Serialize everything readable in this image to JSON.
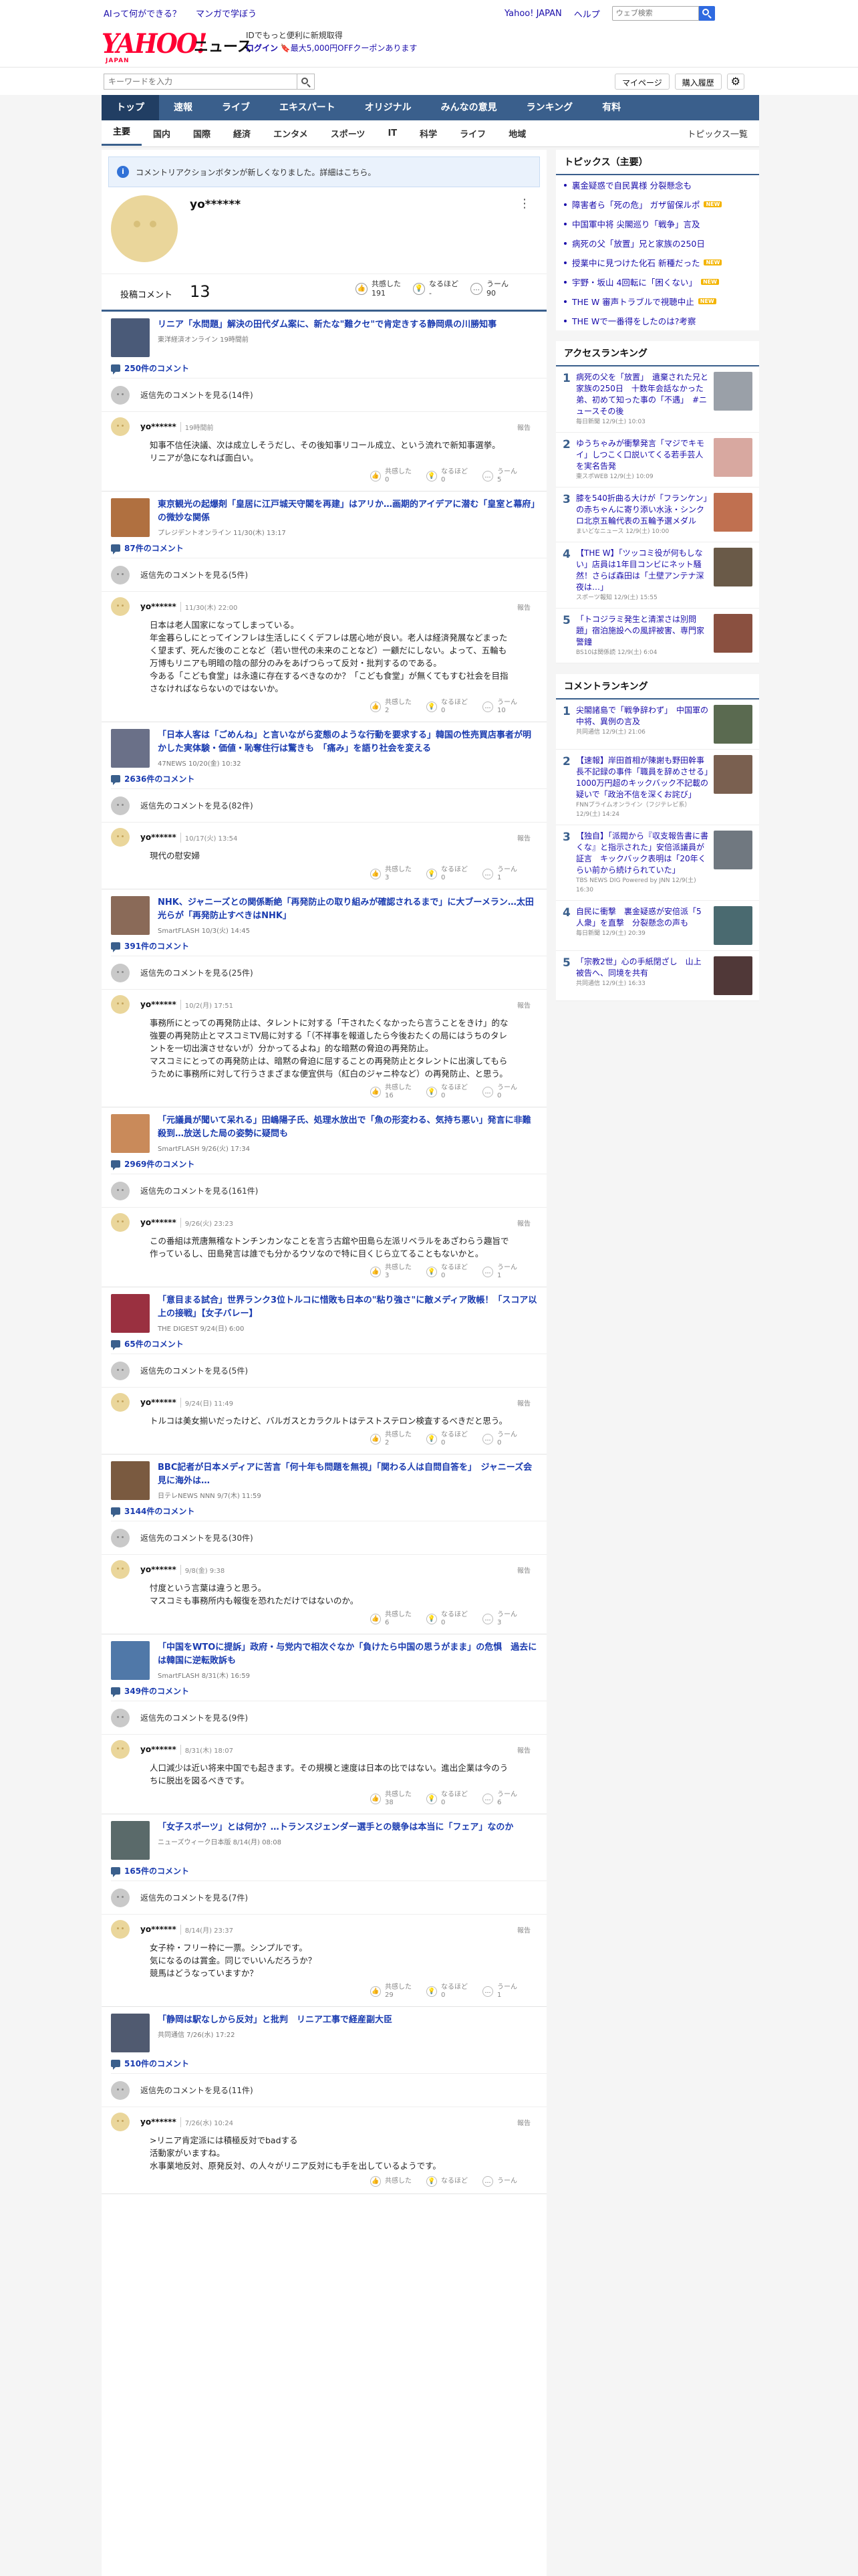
{
  "util": {
    "left": [
      "AIって何ができる？",
      "マンガで学ぼう"
    ],
    "right": [
      "Yahoo! JAPAN",
      "ヘルプ"
    ],
    "search_placeholder": "ウェブ検索"
  },
  "brand": {
    "logo": "YAHOO!",
    "logo_sub": "JAPAN",
    "news": "ニュース",
    "promo_line1": "IDでもっと便利に新規取得",
    "promo_line2a": "ログイン",
    "promo_line2b": "最大5,000円OFFクーポンあります"
  },
  "toolbar": {
    "kw_placeholder": "キーワードを入力",
    "mypage": "マイページ",
    "purchased": "購入履歴"
  },
  "gnav": [
    "トップ",
    "速報",
    "ライブ",
    "エキスパート",
    "オリジナル",
    "みんなの意見",
    "ランキング",
    "有料"
  ],
  "subnav": [
    "主要",
    "国内",
    "国際",
    "経済",
    "エンタメ",
    "スポーツ",
    "IT",
    "科学",
    "ライフ",
    "地域"
  ],
  "subnav_more": "トピックス一覧",
  "notice": "コメントリアクションボタンが新しくなりました。詳細はこちら。",
  "profile": {
    "name": "yo******",
    "comments_label": "投稿コメント",
    "comments_count": "13",
    "reactions": [
      {
        "icon": "👍",
        "label": "共感した",
        "value": "191"
      },
      {
        "icon": "💡",
        "label": "なるほど",
        "value": "-"
      },
      {
        "icon": "…",
        "label": "うーん",
        "value": "90"
      }
    ]
  },
  "entries": [
    {
      "title": "リニア「水問題」解決の田代ダム案に、新たな\"難クセ\"で肯定きする静岡県の川勝知事",
      "source": "東洋経済オンライン 19時間前",
      "count": "250件のコメント",
      "thread": "返信先のコメントを見る(14件)",
      "user": "yo******",
      "date": "19時間前",
      "report": "報告",
      "body": "知事不信任決議、次は成立しそうだし、その後知事リコール成立、という流れで新知事選挙。\nリニアが急になれば面白い。",
      "r": [
        "0",
        "0",
        "5"
      ]
    },
    {
      "title": "東京観光の起爆剤「皇居に江戸城天守閣を再建」はアリか…画期的アイデアに潜む「皇室と幕府」の微妙な関係",
      "source": "プレジデントオンライン 11/30(木) 13:17",
      "count": "87件のコメント",
      "thread": "返信先のコメントを見る(5件)",
      "user": "yo******",
      "date": "11/30(木) 22:00",
      "report": "報告",
      "body": "日本は老人国家になってしまっている。\n年金暮らしにとってインフレは生活しにくくデフレは居心地が良い。老人は経済発展などまったく望まず、死んだ後のことなど（若い世代の未来のことなど）一顧だにしない。よって、五輪も万博もリニアも明暗の陰の部分のみをあげつらって反対・批判するのである。\n今ある「こども食堂」は永遠に存在するべきなのか？「こども食堂」が無くてもすむ社会を目指さなければならないのではないか。",
      "r": [
        "2",
        "0",
        "10"
      ]
    },
    {
      "title": "「日本人客は「ごめんね」と言いながら変態のような行動を要求する」韓国の性売買店事者が明かした実体験・価値・恥奪住行は驚きも　「痛み」を語り社会を変える",
      "source": "47NEWS 10/20(金) 10:32",
      "count": "2636件のコメント",
      "thread": "返信先のコメントを見る(82件)",
      "user": "yo******",
      "date": "10/17(火) 13:54",
      "report": "報告",
      "body": "現代の慰安婦",
      "r": [
        "3",
        "0",
        "1"
      ]
    },
    {
      "title": "NHK、ジャニーズとの関係断絶「再発防止の取り組みが確認されるまで」に大ブーメラン…太田光らが「再発防止すべきはNHK」",
      "source": "SmartFLASH 10/3(火) 14:45",
      "count": "391件のコメント",
      "thread": "返信先のコメントを見る(25件)",
      "user": "yo******",
      "date": "10/2(月) 17:51",
      "report": "報告",
      "body": "事務所にとっての再発防止は、タレントに対する「干されたくなかったら言うことをきけ」的な強要の再発防止とマスコミTV局に対する「（不祥事を報道したら今後おたくの局にはうちのタレントを一切出演させないが）分かってるよね」的な暗黙の脅迫の再発防止。\nマスコミにとっての再発防止は、暗黙の脅迫に屈することの再発防止とタレントに出演してもらうために事務所に対して行うさまざまな便宜供与（紅白のジャニ枠など）の再発防止、と思う。",
      "r": [
        "16",
        "0",
        "0"
      ]
    },
    {
      "title": "「元議員が聞いて呆れる」田嶋陽子氏、処理水放出で「魚の形変わる、気持ち悪い」発言に非難殺到…放送した局の姿勢に疑問も",
      "source": "SmartFLASH 9/26(火) 17:34",
      "count": "2969件のコメント",
      "thread": "返信先のコメントを見る(161件)",
      "user": "yo******",
      "date": "9/26(火) 23:23",
      "report": "報告",
      "body": "この番組は荒唐無稽なトンチンカンなことを言う古舘や田島ら左派リベラルをあざわらう趣旨で作っているし、田島発言は誰でも分かるウソなので特に目くじら立てることもないかと。",
      "r": [
        "3",
        "0",
        "1"
      ]
    },
    {
      "title": "「意目まる試合」世界ランク3位トルコに惜敗も日本の\"粘り強さ\"に敵メディア敗帳！「スコア以上の接戦」【女子バレー】",
      "source": "THE DIGEST 9/24(日) 6:00",
      "count": "65件のコメント",
      "thread": "返信先のコメントを見る(5件)",
      "user": "yo******",
      "date": "9/24(日) 11:49",
      "report": "報告",
      "body": "トルコは美女揃いだったけど、バルガスとカラクルトはテストステロン検査するべきだと思う。",
      "r": [
        "2",
        "0",
        "0"
      ]
    },
    {
      "title": "BBC記者が日本メディアに苦言「何十年も問題を無視」「関わる人は自問自答を」　ジャニーズ会見に海外は…",
      "source": "日テレNEWS NNN 9/7(木) 11:59",
      "count": "3144件のコメント",
      "thread": "返信先のコメントを見る(30件)",
      "user": "yo******",
      "date": "9/8(金) 9:38",
      "report": "報告",
      "body": "忖度という言葉は違うと思う。\nマスコミも事務所内も報復を恐れただけではないのか。",
      "r": [
        "6",
        "0",
        "3"
      ]
    },
    {
      "title": "「中国をWTOに提訴」政府・与党内で相次ぐなか「負けたら中国の思うがまま」の危惧　過去には韓国に逆転敗訴も",
      "source": "SmartFLASH 8/31(木) 16:59",
      "count": "349件のコメント",
      "thread": "返信先のコメントを見る(9件)",
      "user": "yo******",
      "date": "8/31(木) 18:07",
      "report": "報告",
      "body": "人口減少は近い将来中国でも起きます。その規模と速度は日本の比ではない。進出企業は今のうちに脱出を図るべきです。",
      "r": [
        "38",
        "0",
        "6"
      ]
    },
    {
      "title": "「女子スポーツ」とは何か？…トランスジェンダー選手との競争は本当に「フェア」なのか",
      "source": "ニューズウィーク日本版 8/14(月) 08:08",
      "count": "165件のコメント",
      "thread": "返信先のコメントを見る(7件)",
      "user": "yo******",
      "date": "8/14(月) 23:37",
      "report": "報告",
      "body": "女子枠・フリー枠に一票。シンプルです。\n気になるのは賞金。同じでいいんだろうか？\n競馬はどうなっていますか？",
      "r": [
        "29",
        "0",
        "1"
      ]
    },
    {
      "title": "「静岡は駅なしから反対」と批判　リニア工事で経産副大臣",
      "source": "共同通信 7/26(水) 17:22",
      "count": "510件のコメント",
      "thread": "返信先のコメントを見る(11件)",
      "user": "yo******",
      "date": "7/26(水) 10:24",
      "report": "報告",
      "body": ">リニア肯定派には積極反対でbadする\n活動家がいますね。\n水事業地反対、原発反対、の人々がリニア反対にも手を出しているようです。",
      "r": [
        "",
        "",
        ""
      ]
    }
  ],
  "side": {
    "topics_title": "トピックス（主要）",
    "topics": [
      {
        "t": "裏金疑惑で自民異様 分裂懸念も",
        "new": false
      },
      {
        "t": "障害者ら「死の危」 ガザ留保ルポ",
        "new": true
      },
      {
        "t": "中国軍中将 尖閣巡り「戦争」言及",
        "new": false
      },
      {
        "t": "病死の父「放置」兄と家族の250日",
        "new": false
      },
      {
        "t": "授業中に見つけた化石 新種だった",
        "new": true
      },
      {
        "t": "宇野・坂山 4回転に「困くない」",
        "new": true
      },
      {
        "t": "THE W 審声トラブルで視聴中止",
        "new": true
      },
      {
        "t": "THE Wで一番得をしたのは?考察",
        "new": false
      }
    ],
    "access_title": "アクセスランキング",
    "access": [
      {
        "n": "1",
        "t": "病死の父を「放置」　遺棄された兄と家族の250日　十数年会話なかった弟、初めて知った事の「不遇」　#ニュースその後",
        "s": "毎日新聞 12/9(土) 10:03"
      },
      {
        "n": "2",
        "t": "ゆうちゃみが衝撃発言「マジでキモイ」しつこく口説いてくる若手芸人を実名告発",
        "s": "東スポWEB 12/9(土) 10:09"
      },
      {
        "n": "3",
        "t": "膝を540折曲る大けが「フランケン」の赤ちゃんに寄り添い水泳・シンクロ北京五輪代表の五輪予選メダル",
        "s": "まいどなニュース 12/9(土) 10:00"
      },
      {
        "n": "4",
        "t": "【THE W】「ツッコミ役が何もしない」店員は1年目コンビにネット騒然！さらば森田は「土壁アンテナ深夜は…」",
        "s": "スポーツ報知 12/9(土) 15:55"
      },
      {
        "n": "5",
        "t": "「トコジラミ発生と清潔さは別問題」宿泊施設への風評被害、専門家警鐘",
        "s": "BS10は関係読 12/9(土) 6:04"
      }
    ],
    "comment_title": "コメントランキング",
    "comment": [
      {
        "n": "1",
        "t": "尖閣諸島で「戦争辞わず」　中国軍の中将、異例の言及",
        "s": "共同通信 12/9(土) 21:06"
      },
      {
        "n": "2",
        "t": "【速報】岸田首相が陳謝も野田幹事長不記録の事件「職員を辞めさせる」1000万円超のキックバック不記載の疑いで「政治不信を深くお詫び」",
        "s": "FNNプライムオンライン（フジテレビ系） 12/9(土) 14:24"
      },
      {
        "n": "3",
        "t": "【独自】「派閥から『収支報告書に書くな』と指示された」安倍派議員が証言　キックバック表明は「20年くらい前から続けられていた」",
        "s": "TBS NEWS DIG Powered by JNN 12/9(土) 16:30"
      },
      {
        "n": "4",
        "t": "自民に衝撃　裏金疑惑が安倍派「5人衆」を直撃　分裂懸念の声も",
        "s": "毎日新聞 12/9(土) 20:39"
      },
      {
        "n": "5",
        "t": "「宗教2世」心の手紙閉ざし　山上被告へ、同境を共有",
        "s": "共同通信 12/9(土) 16:33"
      }
    ]
  }
}
